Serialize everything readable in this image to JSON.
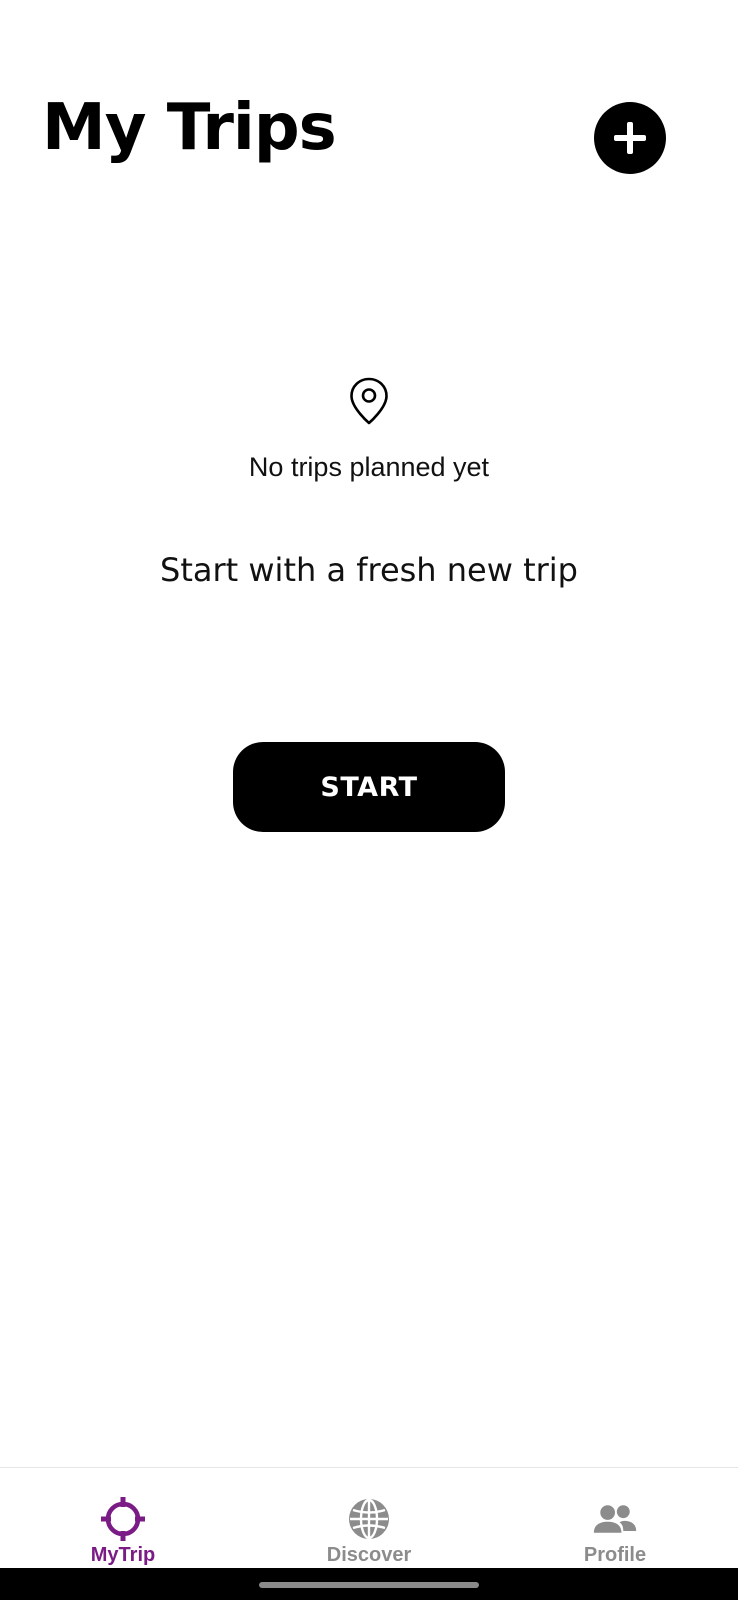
{
  "header": {
    "title": "My Trips",
    "add_icon": "plus-icon"
  },
  "empty_state": {
    "icon": "map-pin-icon",
    "message": "No trips planned yet",
    "subheading": "Start with a fresh new trip",
    "start_label": "START"
  },
  "bottom_nav": {
    "items": [
      {
        "label": "MyTrip",
        "icon": "crosshair-icon",
        "active": true
      },
      {
        "label": "Discover",
        "icon": "globe-icon",
        "active": false
      },
      {
        "label": "Profile",
        "icon": "people-icon",
        "active": false
      }
    ]
  },
  "colors": {
    "active_tab": "#7A1B86",
    "inactive_tab": "#8C8C8C",
    "primary": "#000000",
    "background": "#FFFFFF"
  }
}
